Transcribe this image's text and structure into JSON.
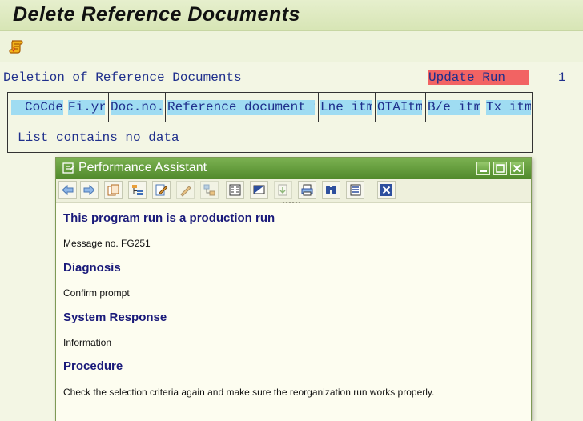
{
  "window": {
    "title": "Delete Reference Documents"
  },
  "toolbar": {
    "icon": "scroll-icon"
  },
  "list": {
    "heading": "Deletion of Reference Documents",
    "run_mode": "Update Run",
    "page": "1",
    "columns": [
      "CoCde",
      "Fi.yr",
      "Doc.no.",
      "Reference document t",
      "Lne itm",
      "OTAItm",
      "B/e itm",
      "Tx itm"
    ],
    "empty_message": "List contains no data"
  },
  "performance_assistant": {
    "title": "Performance Assistant",
    "toolbar_icons": [
      "back-icon",
      "forward-icon",
      "copy-icon",
      "tree-icon",
      "edit-icon",
      "pen-icon",
      "network-icon",
      "book-icon",
      "display-icon",
      "export-icon",
      "print-icon",
      "find-icon",
      "list-icon",
      "close-icon"
    ],
    "heading": "This program run is a production run",
    "message_no": "Message no. FG251",
    "sections": [
      {
        "heading": "Diagnosis",
        "text": "Confirm prompt"
      },
      {
        "heading": "System Response",
        "text": "Information"
      },
      {
        "heading": "Procedure",
        "text": "Check the selection criteria again and make sure the reorganization run works properly."
      }
    ]
  },
  "colors": {
    "title_bar": "#d7e5b5",
    "header_cell": "#9fdcf2",
    "update_run": "#f26363",
    "pa_titlebar": "#5e9a35",
    "heading_text": "#1a1a7a"
  }
}
